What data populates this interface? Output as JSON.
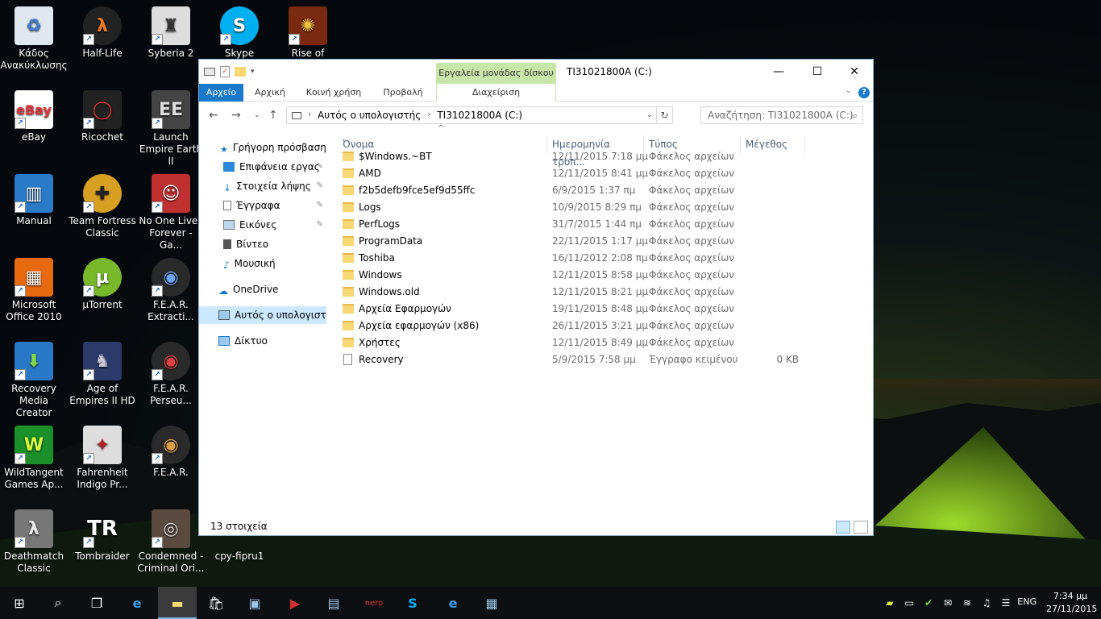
{
  "desktop": {
    "icons": [
      {
        "label": "Κάδος Ανακύκλωσης",
        "icon": "recycle-bin-icon"
      },
      {
        "label": "Half-Life",
        "icon": "half-life-icon"
      },
      {
        "label": "Syberia 2",
        "icon": "syberia-icon"
      },
      {
        "label": "Skype",
        "icon": "skype-icon"
      },
      {
        "label": "Rise of Nations",
        "icon": "rise-of-nations-icon"
      },
      {
        "label": "eBay",
        "icon": "ebay-icon"
      },
      {
        "label": "Ricochet",
        "icon": "ricochet-icon"
      },
      {
        "label": "Launch Empire Earth II",
        "icon": "empire-earth-icon"
      },
      {
        "label": "Manual",
        "icon": "manual-icon"
      },
      {
        "label": "Team Fortress Classic",
        "icon": "team-fortress-icon"
      },
      {
        "label": "No One Lives Forever - Ga...",
        "icon": "nolf-icon"
      },
      {
        "label": "Microsoft Office 2010",
        "icon": "office-icon"
      },
      {
        "label": "µTorrent",
        "icon": "utorrent-icon"
      },
      {
        "label": "F.E.A.R. Extracti...",
        "icon": "fear-icon"
      },
      {
        "label": "Recovery Media Creator",
        "icon": "recovery-media-icon"
      },
      {
        "label": "Age of Empires II HD",
        "icon": "age-of-empires-icon"
      },
      {
        "label": "F.E.A.R. Perseu...",
        "icon": "fear-icon"
      },
      {
        "label": "WildTangent Games Ap...",
        "icon": "wildtangent-icon"
      },
      {
        "label": "Fahrenheit Indigo Pr...",
        "icon": "fahrenheit-icon"
      },
      {
        "label": "F.E.A.R.",
        "icon": "fear-icon"
      },
      {
        "label": "Deathmatch Classic",
        "icon": "deathmatch-icon"
      },
      {
        "label": "Tombraider",
        "icon": "tombraider-icon"
      },
      {
        "label": "Condemned - Criminal Ori...",
        "icon": "condemned-icon"
      },
      {
        "label": "cpy-fipru1",
        "icon": "cpy-icon"
      }
    ]
  },
  "window": {
    "title": "TI31021800A (C:)",
    "tool_tab_header": "Εργαλεία μονάδας δίσκου",
    "tabs": {
      "file": "Αρχείο",
      "home": "Αρχική",
      "share": "Κοινή χρήση",
      "view": "Προβολή",
      "manage": "Διαχείριση"
    },
    "address": {
      "crumb1": "Αυτός ο υπολογιστής",
      "crumb2": "TI31021800A (C:)"
    },
    "search_placeholder": "Αναζήτηση: TI31021800A (C:)",
    "nav": {
      "quick_access": "Γρήγορη πρόσβαση",
      "desktop": "Επιφάνεια εργας",
      "downloads": "Στοιχεία λήψης",
      "documents": "Έγγραφα",
      "pictures": "Εικόνες",
      "videos": "Βίντεο",
      "music": "Μουσική",
      "onedrive": "OneDrive",
      "this_pc": "Αυτός ο υπολογιστής",
      "network": "Δίκτυο"
    },
    "columns": {
      "name": "Όνομα",
      "date": "Ημερομηνία τροπ...",
      "type": "Τύπος",
      "size": "Μέγεθος"
    },
    "files": [
      {
        "name": "$Windows.~BT",
        "date": "12/11/2015 7:18 μμ",
        "type": "Φάκελος αρχείων",
        "size": "",
        "kind": "folder"
      },
      {
        "name": "AMD",
        "date": "12/11/2015 8:41 μμ",
        "type": "Φάκελος αρχείων",
        "size": "",
        "kind": "folder"
      },
      {
        "name": "f2b5defb9fce5ef9d55ffc",
        "date": "6/9/2015 1:37 πμ",
        "type": "Φάκελος αρχείων",
        "size": "",
        "kind": "folder"
      },
      {
        "name": "Logs",
        "date": "10/9/2015 8:29 πμ",
        "type": "Φάκελος αρχείων",
        "size": "",
        "kind": "folder"
      },
      {
        "name": "PerfLogs",
        "date": "31/7/2015 1:44 πμ",
        "type": "Φάκελος αρχείων",
        "size": "",
        "kind": "folder"
      },
      {
        "name": "ProgramData",
        "date": "22/11/2015 1:17 μμ",
        "type": "Φάκελος αρχείων",
        "size": "",
        "kind": "folder"
      },
      {
        "name": "Toshiba",
        "date": "16/11/2012 2:08 πμ",
        "type": "Φάκελος αρχείων",
        "size": "",
        "kind": "folder"
      },
      {
        "name": "Windows",
        "date": "12/11/2015 8:58 μμ",
        "type": "Φάκελος αρχείων",
        "size": "",
        "kind": "folder"
      },
      {
        "name": "Windows.old",
        "date": "12/11/2015 8:21 μμ",
        "type": "Φάκελος αρχείων",
        "size": "",
        "kind": "folder"
      },
      {
        "name": "Αρχεία Εφαρμογών",
        "date": "19/11/2015 8:48 μμ",
        "type": "Φάκελος αρχείων",
        "size": "",
        "kind": "folder"
      },
      {
        "name": "Αρχεία εφαρμογών (x86)",
        "date": "26/11/2015 3:21 μμ",
        "type": "Φάκελος αρχείων",
        "size": "",
        "kind": "folder"
      },
      {
        "name": "Χρήστες",
        "date": "12/11/2015 8:49 μμ",
        "type": "Φάκελος αρχείων",
        "size": "",
        "kind": "folder"
      },
      {
        "name": "Recovery",
        "date": "5/9/2015 7:58 μμ",
        "type": "Έγγραφο κειμένου",
        "size": "0 KB",
        "kind": "text"
      }
    ],
    "status": "13 στοιχεία"
  },
  "taskbar": {
    "lang": "ENG",
    "time": "7:34 μμ",
    "date": "27/11/2015"
  },
  "colors": {
    "accent": "#1979ca",
    "tool_tab": "#c8e6a8",
    "selection": "#cce8ff",
    "taskbar": "#0d0f12"
  }
}
